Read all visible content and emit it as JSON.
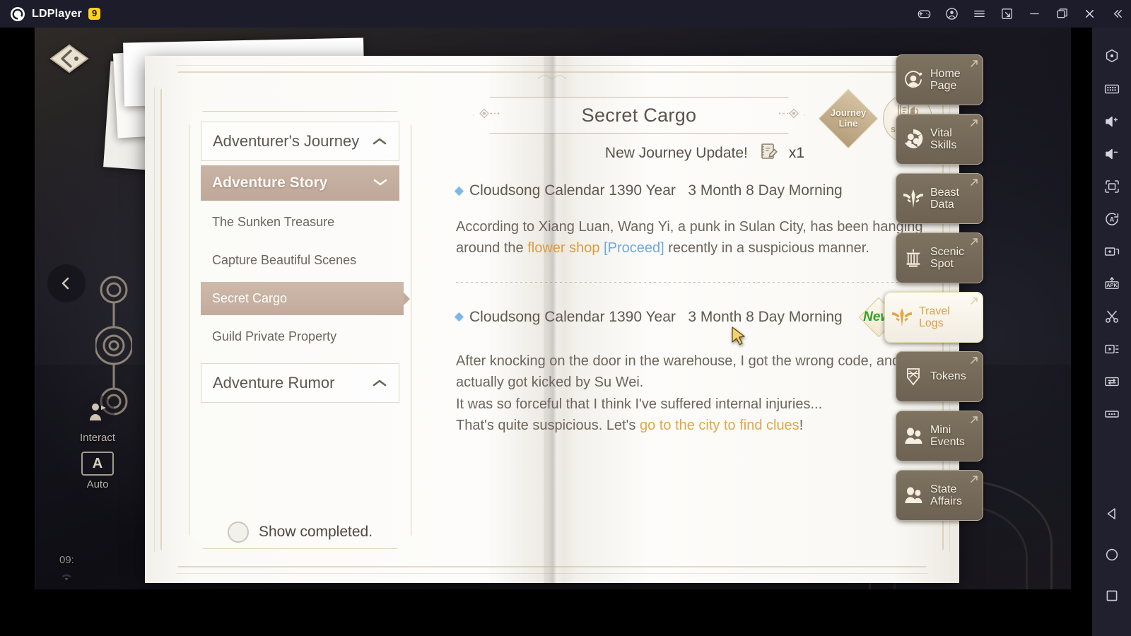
{
  "window": {
    "app_name": "LDPlayer",
    "version_badge": "9",
    "controls": [
      {
        "name": "gamepad-icon",
        "label": "Gamepad"
      },
      {
        "name": "account-icon",
        "label": "Account"
      },
      {
        "name": "menu-icon",
        "label": "Menu"
      },
      {
        "name": "shrink-window-icon",
        "label": "Shrink"
      },
      {
        "name": "minimize-icon",
        "label": "Minimize"
      },
      {
        "name": "maximize-icon",
        "label": "Maximize"
      },
      {
        "name": "close-icon",
        "label": "Close"
      },
      {
        "name": "collapse-icon",
        "label": "Collapse"
      }
    ]
  },
  "hud": {
    "interact_label": "Interact",
    "auto_label": "Auto",
    "auto_glyph": "A",
    "clock": "09:"
  },
  "sidebar": {
    "group1": {
      "label": "Adventurer's Journey",
      "expanded": true,
      "chevron": "up"
    },
    "category": {
      "label": "Adventure Story",
      "expanded": true,
      "chevron": "down"
    },
    "items": [
      {
        "label": "The Sunken Treasure",
        "active": false
      },
      {
        "label": "Capture Beautiful Scenes",
        "active": false
      },
      {
        "label": "Secret Cargo",
        "active": true
      },
      {
        "label": "Guild Private Property",
        "active": false
      }
    ],
    "group2": {
      "label": "Adventure Rumor",
      "expanded": true,
      "chevron": "up"
    },
    "show_completed": {
      "label": "Show completed.",
      "checked": false
    }
  },
  "content": {
    "title": "Secret Cargo",
    "journey_line_badge": {
      "line1": "Journey",
      "line2": "Line"
    },
    "seek_help_badge": {
      "label": "Seek Help"
    },
    "update_banner": {
      "text": "New Journey Update!",
      "count": "x1"
    },
    "entries": [
      {
        "date": "Cloudsong Calendar 1390 Year   3 Month 8 Day Morning",
        "new": false,
        "new_label": "",
        "segments": [
          {
            "text": "According to Xiang Luan, Wang Yi, a punk in Sulan City, has been hanging around the ",
            "style": "normal"
          },
          {
            "text": "flower shop ",
            "style": "orange"
          },
          {
            "text": "[Proceed]",
            "style": "blue"
          },
          {
            "text": " recently in a suspicious manner.",
            "style": "normal"
          }
        ]
      },
      {
        "date": "Cloudsong Calendar 1390 Year   3 Month 8 Day Morning",
        "new": true,
        "new_label": "New",
        "segments": [
          {
            "text": "After knocking on the door in the warehouse, I got the wrong code, and I actually got kicked by Su Wei.",
            "style": "normal",
            "break_after": true
          },
          {
            "text": "It was so forceful that I think I've suffered internal injuries...",
            "style": "normal",
            "break_after": true
          },
          {
            "text": "That's quite suspicious. Let's ",
            "style": "normal"
          },
          {
            "text": "go to the city to find clues",
            "style": "gold"
          },
          {
            "text": "!",
            "style": "normal"
          }
        ]
      }
    ]
  },
  "game_menu": {
    "buttons": [
      {
        "line1": "Home",
        "line2": "Page",
        "icon": "home-page-icon",
        "highlight": false
      },
      {
        "line1": "Vital",
        "line2": "Skills",
        "icon": "vital-skills-icon",
        "highlight": false
      },
      {
        "line1": "Beast",
        "line2": "Data",
        "icon": "beast-data-icon",
        "highlight": false
      },
      {
        "line1": "Scenic",
        "line2": "Spot",
        "icon": "scenic-spot-icon",
        "highlight": false
      },
      {
        "line1": "Travel",
        "line2": "Logs",
        "icon": "travel-logs-icon",
        "highlight": true
      },
      {
        "line1": "Tokens",
        "line2": "",
        "icon": "tokens-icon",
        "highlight": false
      },
      {
        "line1": "Mini",
        "line2": "Events",
        "icon": "mini-events-icon",
        "highlight": false
      },
      {
        "line1": "State",
        "line2": "Affairs",
        "icon": "state-affairs-icon",
        "highlight": false
      }
    ]
  },
  "ld_toolbar": {
    "tools": [
      "settings-icon",
      "keyboard-icon",
      "volume-up-icon",
      "volume-down-icon",
      "fullscreen-icon",
      "auto-rotate-icon",
      "multi-instance-icon",
      "install-apk-icon",
      "screenshot-icon",
      "record-video-icon",
      "file-transfer-icon",
      "more-icon"
    ],
    "nav": [
      "back-icon",
      "home-icon",
      "recents-icon"
    ]
  },
  "colors": {
    "accent_gold": "#d9a23f",
    "highlight_orange": "#e09a3d",
    "link_blue": "#6fa8dc",
    "new_green": "#35a023",
    "brand_yellow": "#ffd21e",
    "titlebar": "#1c1c2b"
  }
}
